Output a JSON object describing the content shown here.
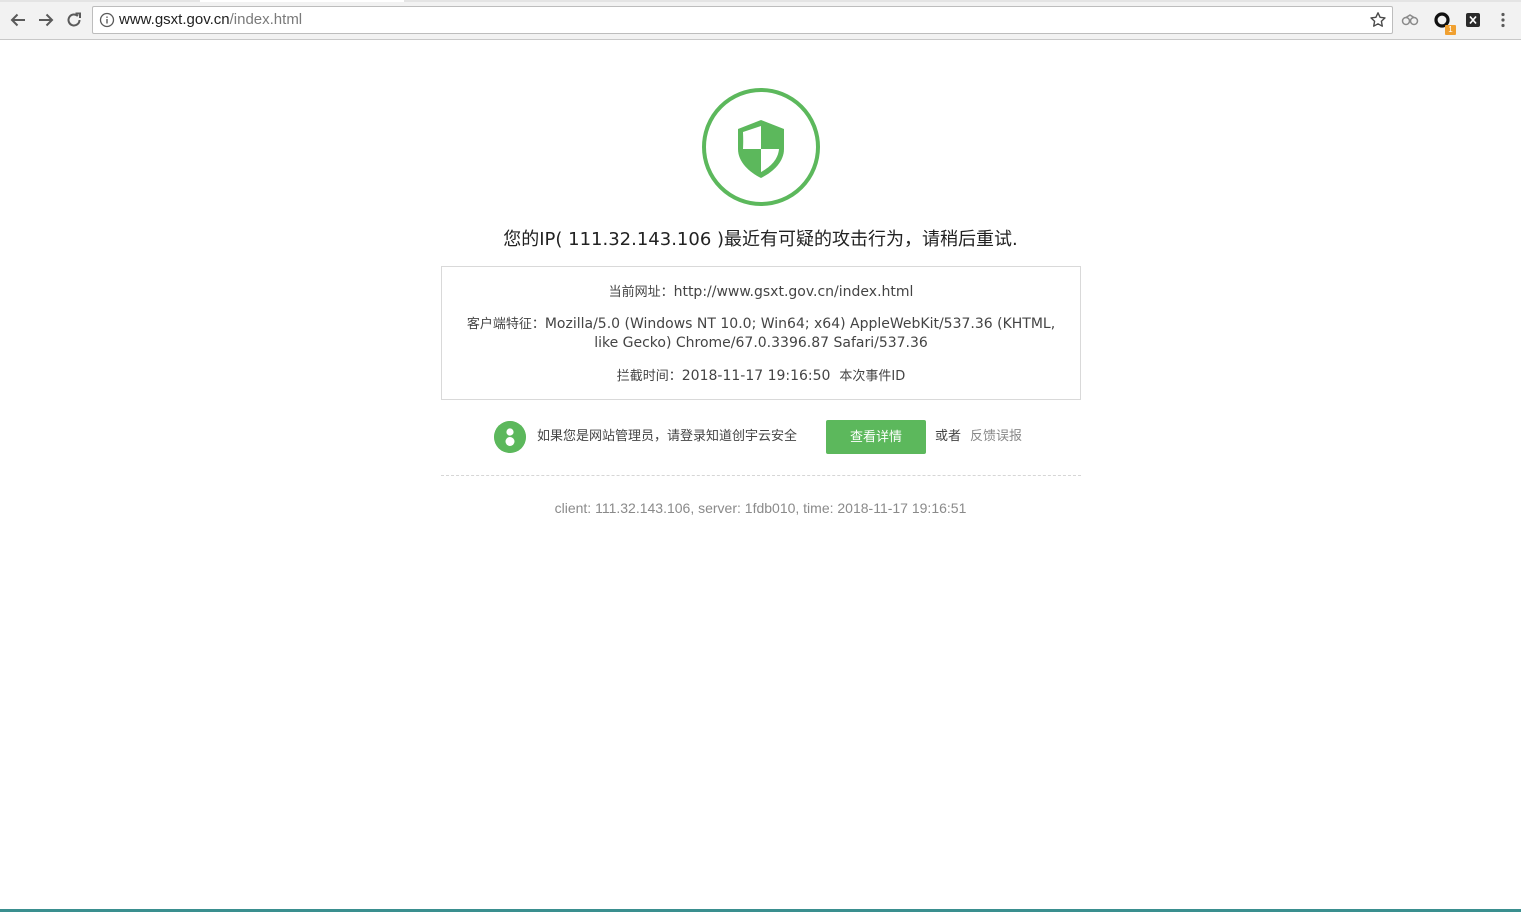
{
  "browser": {
    "url_host": "www.gsxt.gov.cn",
    "url_path": "/index.html",
    "buttons": {
      "back": "back-arrow-icon",
      "forward": "forward-arrow-icon",
      "reload": "reload-icon"
    },
    "extensions": [
      {
        "name": "cloud-extension-icon"
      },
      {
        "name": "ring-extension-icon",
        "badge": "1"
      },
      {
        "name": "x-extension-icon"
      }
    ]
  },
  "page": {
    "headline": "您的IP( 111.32.143.106 )最近有可疑的攻击行为，请稍后重试.",
    "info": {
      "url_label": "当前网址：",
      "url_value": "http://www.gsxt.gov.cn/index.html",
      "client_label": "客户端特征：",
      "client_value": "Mozilla/5.0 (Windows NT 10.0; Win64; x64) AppleWebKit/537.36 (KHTML, like Gecko) Chrome/67.0.3396.87 Safari/537.36",
      "time_label": "拦截时间：",
      "time_value": "2018-11-17 19:16:50",
      "event_label": "本次事件ID"
    },
    "admin": {
      "text": "如果您是网站管理员，请登录知道创宇云安全",
      "button_label": "查看详情",
      "or_text": "或者",
      "feedback_label": "反馈误报"
    },
    "footer": "client: 111.32.143.106, server: 1fdb010, time: 2018-11-17 19:16:51"
  },
  "colors": {
    "accent_green": "#5cb85c",
    "shield_green": "#5cb85c",
    "muted_text": "#8a8a8a"
  }
}
